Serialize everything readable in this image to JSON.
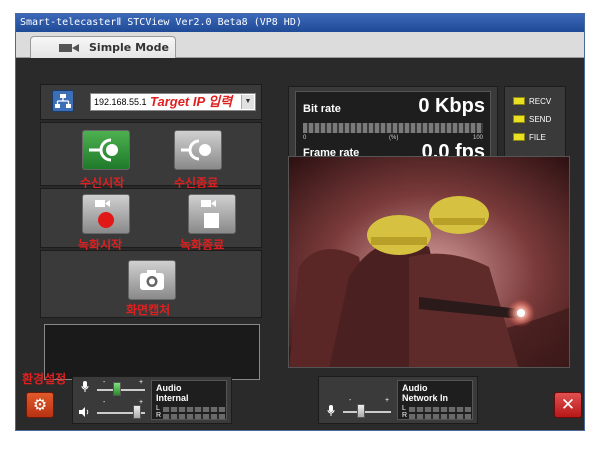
{
  "window": {
    "title": "Smart-telecasterⅡ STCView Ver2.0 Beta8 (VP8 HD)"
  },
  "tab": {
    "label": "Simple Mode"
  },
  "connection": {
    "ip_value": "192.168.55.1",
    "ip_annotation": "Target IP 입력"
  },
  "buttons": {
    "receive_start": "수신시작",
    "receive_stop": "수신종료",
    "record_start": "녹화시작",
    "record_stop": "녹화종료",
    "capture": "화면캡처",
    "settings": "환경설정"
  },
  "meters": {
    "bitrate_label": "Bit rate",
    "bitrate_value": "0 Kbps",
    "scale_min": "0",
    "scale_unit": "(%)",
    "scale_max": "100",
    "framerate_label": "Frame rate",
    "framerate_value": "0.0 fps"
  },
  "status": {
    "recv": "RECV",
    "send": "SEND",
    "file": "FILE"
  },
  "audio": {
    "internal_line1": "Audio",
    "internal_line2": "Internal",
    "network_line1": "Audio",
    "network_line2": "Network In",
    "left": "L",
    "right": "R",
    "minus": "-",
    "plus": "+"
  },
  "colors": {
    "accent_green": "#2e8b34",
    "annotation_red": "#e02020",
    "led_yellow": "#e8e020"
  },
  "icons": {
    "network": "network-icon",
    "camera": "camera-icon",
    "settings": "gear-icon",
    "close": "close-icon",
    "mic": "mic-icon",
    "speaker": "speaker-icon"
  }
}
